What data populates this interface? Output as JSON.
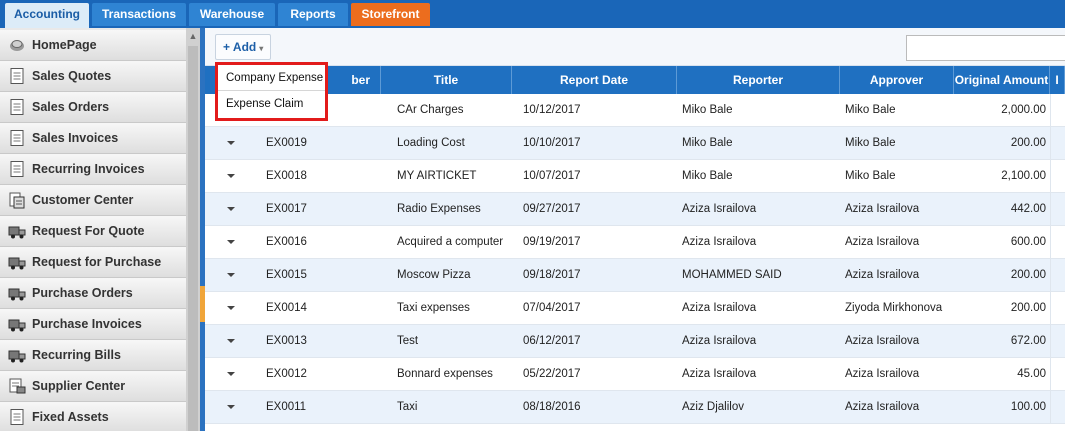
{
  "tabs": [
    {
      "label": "Accounting",
      "active": true
    },
    {
      "label": "Transactions"
    },
    {
      "label": "Warehouse"
    },
    {
      "label": "Reports"
    },
    {
      "label": "Storefront"
    }
  ],
  "sidebar": {
    "items": [
      {
        "label": "HomePage",
        "icon": "home-icon"
      },
      {
        "label": "Sales Quotes",
        "icon": "document-icon"
      },
      {
        "label": "Sales Orders",
        "icon": "document-icon"
      },
      {
        "label": "Sales Invoices",
        "icon": "document-icon"
      },
      {
        "label": "Recurring Invoices",
        "icon": "document-icon"
      },
      {
        "label": "Customer Center",
        "icon": "customer-icon"
      },
      {
        "label": "Request For Quote",
        "icon": "truck-icon"
      },
      {
        "label": "Request for Purchase",
        "icon": "truck-icon"
      },
      {
        "label": "Purchase Orders",
        "icon": "truck-icon"
      },
      {
        "label": "Purchase Invoices",
        "icon": "truck-icon"
      },
      {
        "label": "Recurring Bills",
        "icon": "truck-icon"
      },
      {
        "label": "Supplier Center",
        "icon": "supplier-icon"
      },
      {
        "label": "Fixed Assets",
        "icon": "document-icon"
      }
    ]
  },
  "toolbar": {
    "add_label": "+ Add",
    "add_caret": "▾"
  },
  "dropdown": {
    "items": [
      "Company Expense",
      "Expense Claim"
    ]
  },
  "grid": {
    "headers": [
      "",
      "ber",
      "Title",
      "Report Date",
      "Reporter",
      "Approver",
      "Original Amount",
      "I"
    ],
    "rows": [
      {
        "number": "",
        "title": "CAr Charges",
        "date": "10/12/2017",
        "reporter": "Miko Bale",
        "approver": "Miko Bale",
        "amount": "2,000.00"
      },
      {
        "number": "EX0019",
        "title": "Loading Cost",
        "date": "10/10/2017",
        "reporter": "Miko Bale",
        "approver": "Miko Bale",
        "amount": "200.00"
      },
      {
        "number": "EX0018",
        "title": "MY AIRTICKET",
        "date": "10/07/2017",
        "reporter": "Miko Bale",
        "approver": "Miko Bale",
        "amount": "2,100.00"
      },
      {
        "number": "EX0017",
        "title": "Radio Expenses",
        "date": "09/27/2017",
        "reporter": "Aziza Israilova",
        "approver": "Aziza Israilova",
        "amount": "442.00"
      },
      {
        "number": "EX0016",
        "title": "Acquired a computer",
        "date": "09/19/2017",
        "reporter": "Aziza Israilova",
        "approver": "Aziza Israilova",
        "amount": "600.00"
      },
      {
        "number": "EX0015",
        "title": "Moscow Pizza",
        "date": "09/18/2017",
        "reporter": "MOHAMMED SAID",
        "approver": "Aziza Israilova",
        "amount": "200.00"
      },
      {
        "number": "EX0014",
        "title": "Taxi expenses",
        "date": "07/04/2017",
        "reporter": "Aziza Israilova",
        "approver": "Ziyoda Mirkhonova",
        "amount": "200.00"
      },
      {
        "number": "EX0013",
        "title": "Test",
        "date": "06/12/2017",
        "reporter": "Aziza Israilova",
        "approver": "Aziza Israilova",
        "amount": "672.00"
      },
      {
        "number": "EX0012",
        "title": "Bonnard expenses",
        "date": "05/22/2017",
        "reporter": "Aziza Israilova",
        "approver": "Aziza Israilova",
        "amount": "45.00"
      },
      {
        "number": "EX0011",
        "title": "Taxi",
        "date": "08/18/2016",
        "reporter": "Aziz Djalilov",
        "approver": "Aziza Israilova",
        "amount": "100.00"
      }
    ]
  },
  "colors": {
    "topbar": "#1a66b8",
    "tab": "#2f84d3",
    "tab_active": "#dcecf8",
    "storefront": "#ec6d1e",
    "grid_header": "#1f70c1",
    "highlight_border": "#e21b1b"
  }
}
